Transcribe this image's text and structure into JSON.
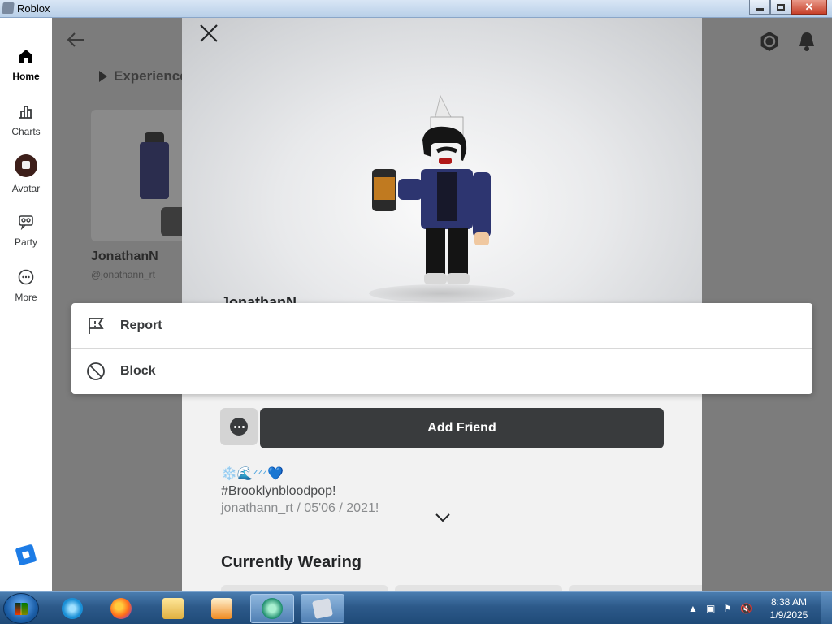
{
  "window": {
    "title": "Roblox",
    "controls": [
      "minimize",
      "maximize",
      "close"
    ]
  },
  "leftnav": {
    "items": [
      {
        "label": "Home",
        "icon": "home-icon",
        "active": true
      },
      {
        "label": "Charts",
        "icon": "charts-icon",
        "active": false
      },
      {
        "label": "Avatar",
        "icon": "avatar-icon",
        "active": false
      },
      {
        "label": "Party",
        "icon": "party-icon",
        "active": false
      },
      {
        "label": "More",
        "icon": "more-icon",
        "active": false
      }
    ]
  },
  "background": {
    "tab_label": "Experience",
    "friend_name": "JonathanN",
    "friend_handle": "@jonathann_rt"
  },
  "profile": {
    "display_name": "JonathanN",
    "add_friend_label": "Add Friend",
    "bio_emoji": "❄️🌊ᶻᶻᶻ💙",
    "bio_line2": "#Brooklynbloodpop!",
    "bio_line3": "jonathann_rt / 05'06 / 2021!",
    "currently_wearing_title": "Currently Wearing"
  },
  "context_menu": {
    "items": [
      {
        "label": "Report",
        "icon": "flag-icon"
      },
      {
        "label": "Block",
        "icon": "block-icon"
      }
    ]
  },
  "taskbar": {
    "time": "8:38 AM",
    "date": "1/9/2025"
  },
  "colors": {
    "accent_dark": "#393b3d",
    "modal_bg": "#f2f2f2",
    "dim_bg": "#7f7f7f"
  }
}
